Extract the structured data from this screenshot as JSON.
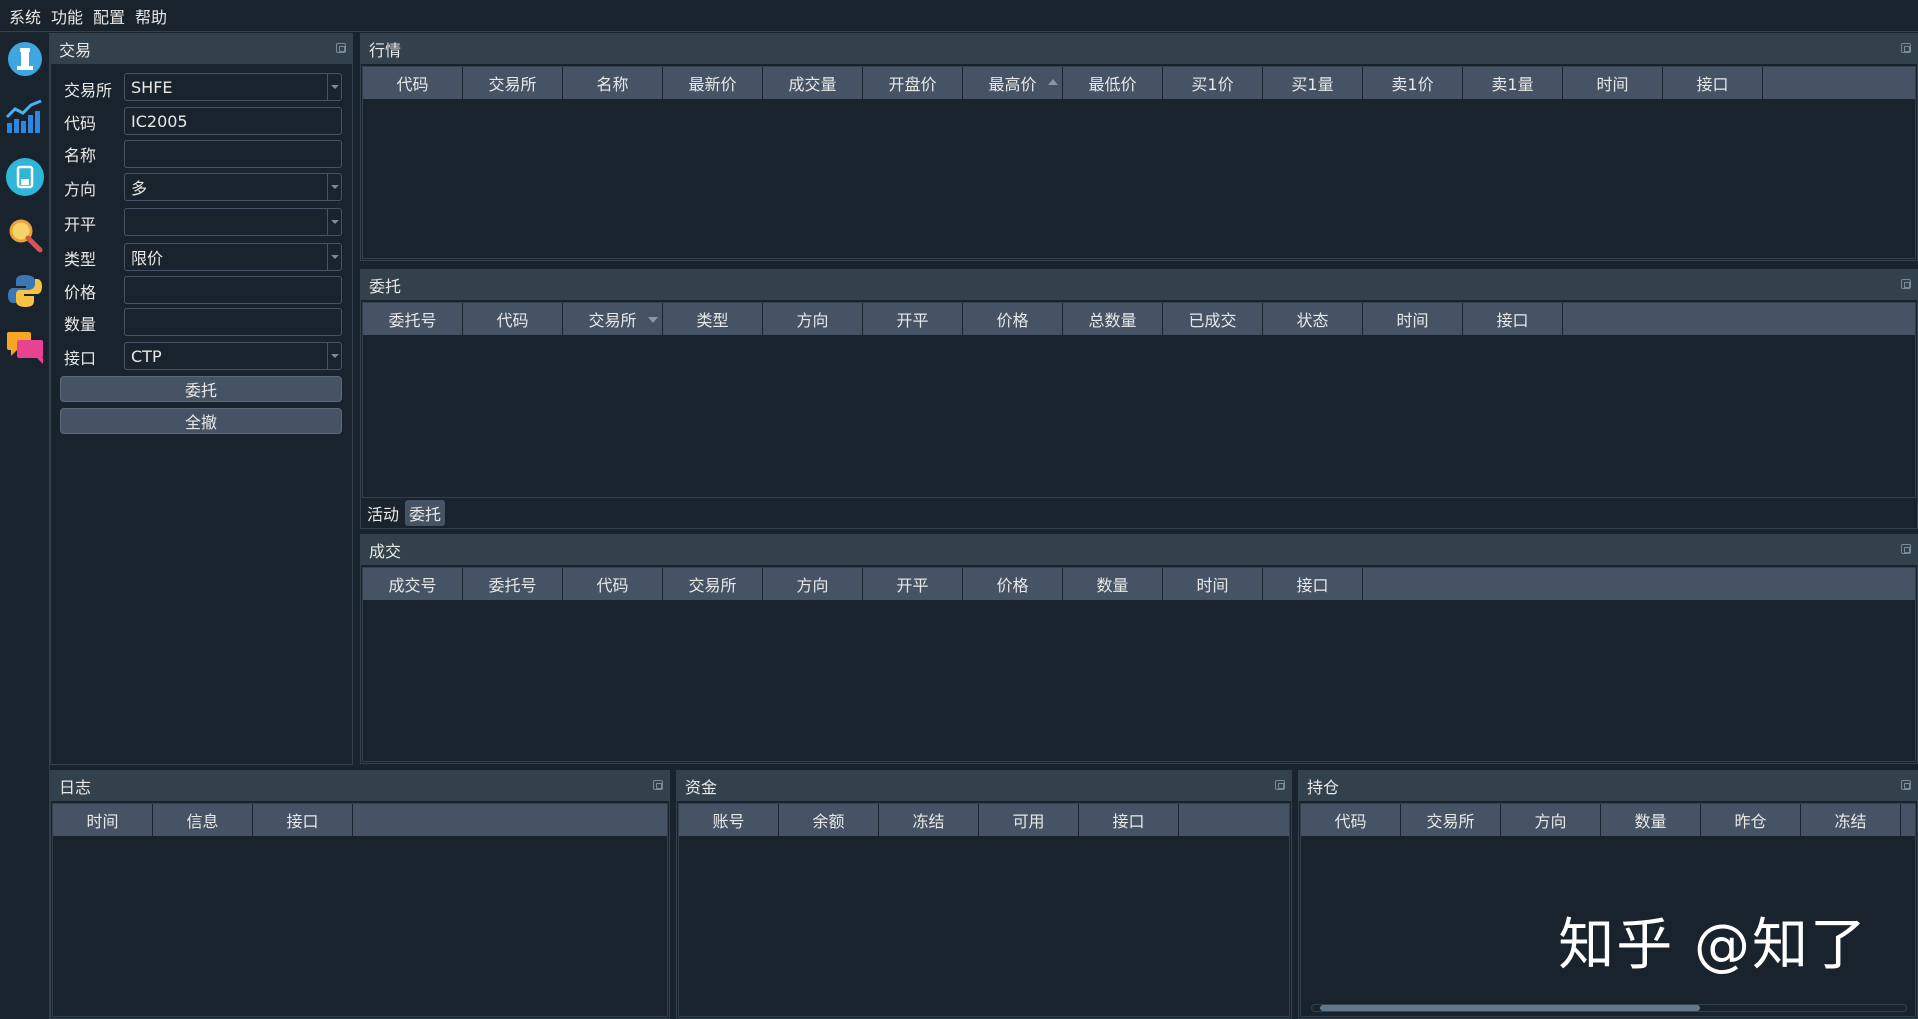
{
  "menu": [
    "系统",
    "功能",
    "配置",
    "帮助"
  ],
  "toolbar": [
    "trading-icon",
    "chart-icon",
    "database-icon",
    "search-icon",
    "python-icon",
    "chat-icon"
  ],
  "trade_panel": {
    "title": "交易",
    "labels": [
      "交易所",
      "代码",
      "名称",
      "方向",
      "开平",
      "类型",
      "价格",
      "数量",
      "接口"
    ],
    "exchange": "SHFE",
    "symbol": "IC2005",
    "name": "",
    "direction": "多",
    "offset": "",
    "order_type": "限价",
    "price": "",
    "volume": "",
    "gateway": "CTP",
    "send_button": "委托",
    "cancel_all_button": "全撤"
  },
  "tick_panel": {
    "title": "行情",
    "columns": [
      "代码",
      "交易所",
      "名称",
      "最新价",
      "成交量",
      "开盘价",
      "最高价",
      "最低价",
      "买1价",
      "买1量",
      "卖1价",
      "卖1量",
      "时间",
      "接口"
    ]
  },
  "order_panel": {
    "title": "委托",
    "columns": [
      "委托号",
      "代码",
      "交易所",
      "类型",
      "方向",
      "开平",
      "价格",
      "总数量",
      "已成交",
      "状态",
      "时间",
      "接口"
    ],
    "tabs": [
      "活动",
      "委托"
    ]
  },
  "trade_record_panel": {
    "title": "成交",
    "columns": [
      "成交号",
      "委托号",
      "代码",
      "交易所",
      "方向",
      "开平",
      "价格",
      "数量",
      "时间",
      "接口"
    ]
  },
  "log_panel": {
    "title": "日志",
    "columns": [
      "时间",
      "信息",
      "接口"
    ]
  },
  "account_panel": {
    "title": "资金",
    "columns": [
      "账号",
      "余额",
      "冻结",
      "可用",
      "接口"
    ]
  },
  "position_panel": {
    "title": "持仓",
    "columns": [
      "代码",
      "交易所",
      "方向",
      "数量",
      "昨仓",
      "冻结"
    ]
  },
  "watermark": "知乎 @知了"
}
